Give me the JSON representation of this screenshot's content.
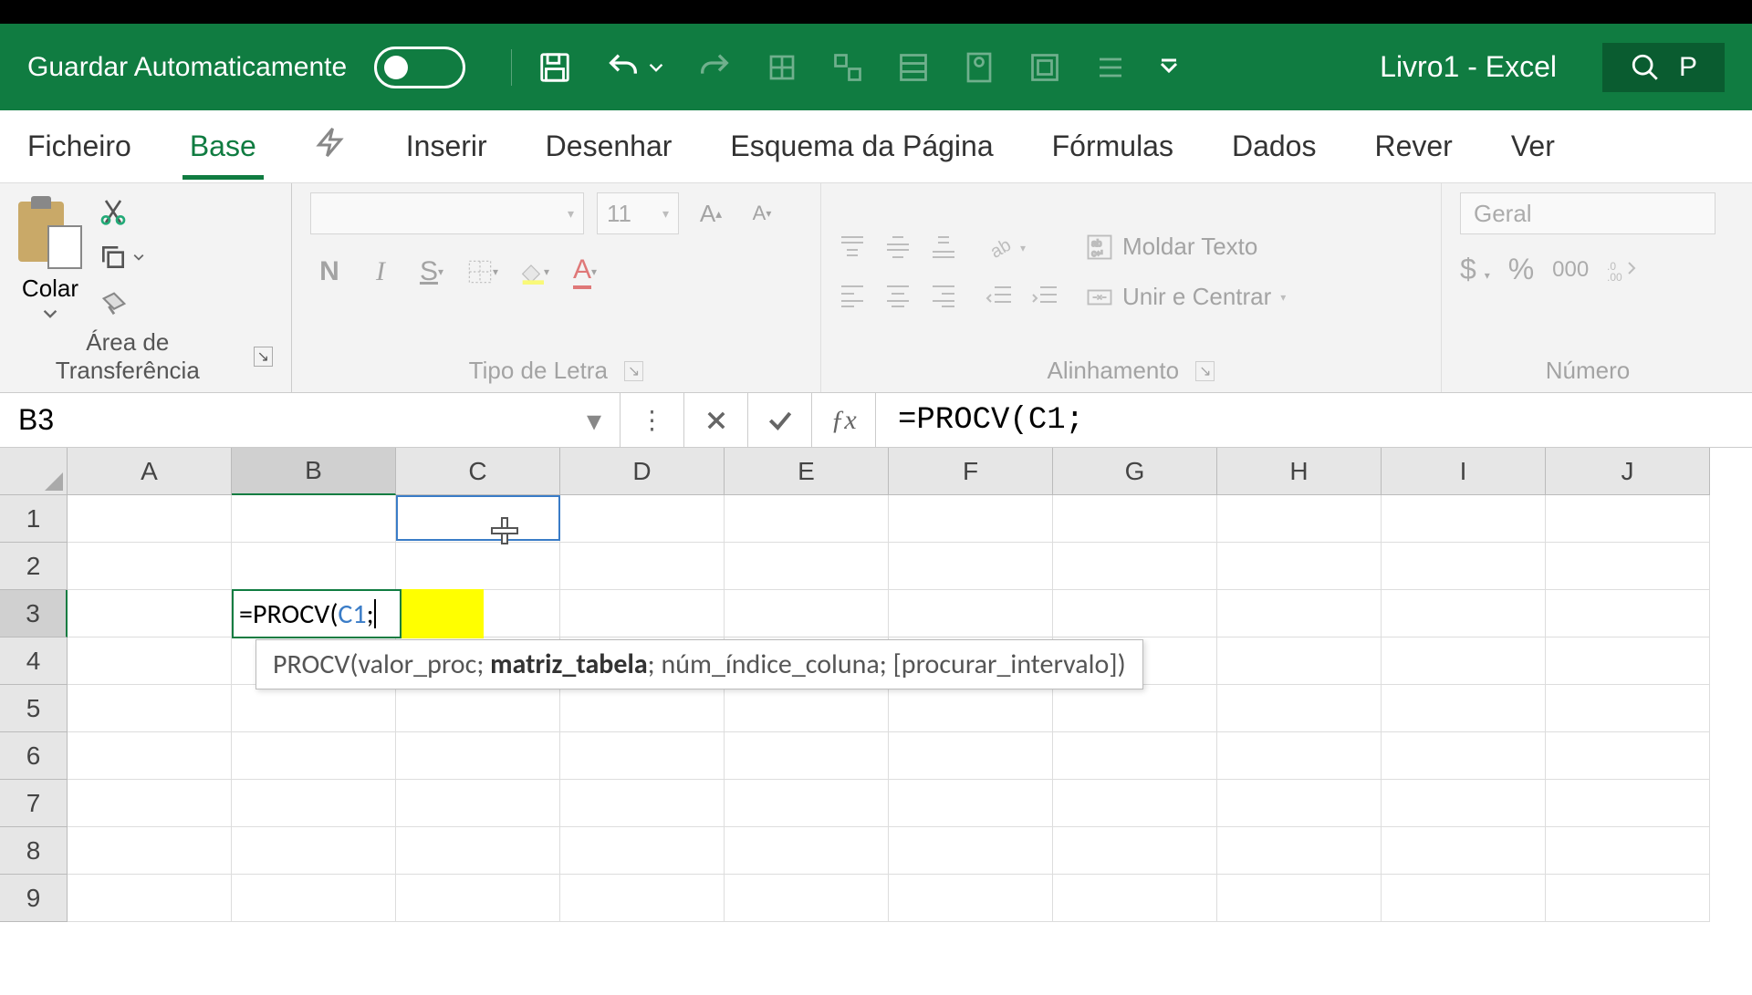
{
  "titleBar": {
    "autoSaveLabel": "Guardar Automaticamente",
    "docTitle": "Livro1  -  Excel",
    "searchPlaceholder": "P"
  },
  "tabs": {
    "file": "Ficheiro",
    "home": "Base",
    "insert": "Inserir",
    "draw": "Desenhar",
    "pageLayout": "Esquema da Página",
    "formulas": "Fórmulas",
    "data": "Dados",
    "review": "Rever",
    "view": "Ver"
  },
  "ribbon": {
    "clipboard": {
      "paste": "Colar",
      "groupLabel": "Área de Transferência"
    },
    "font": {
      "size": "11",
      "groupLabel": "Tipo de Letra",
      "bold": "N",
      "italic": "I",
      "underline": "S"
    },
    "alignment": {
      "wrap": "Moldar Texto",
      "merge": "Unir e Centrar",
      "groupLabel": "Alinhamento"
    },
    "number": {
      "format": "Geral",
      "thousands": "000",
      "groupLabel": "Número"
    }
  },
  "formulaBar": {
    "nameBox": "B3",
    "formula": "=PROCV(C1;"
  },
  "grid": {
    "columns": [
      "A",
      "B",
      "C",
      "D",
      "E",
      "F",
      "G",
      "H",
      "I",
      "J"
    ],
    "rows": [
      "1",
      "2",
      "3",
      "4",
      "5",
      "6",
      "7",
      "8",
      "9"
    ],
    "editingCell": {
      "prefix": "=PROCV(",
      "ref": "C1",
      "suffix": ";"
    },
    "tooltip": {
      "fname": "PROCV",
      "arg1": "valor_proc",
      "arg2": "matriz_tabela",
      "arg3": "núm_índice_coluna",
      "arg4": "[procurar_intervalo]"
    }
  }
}
